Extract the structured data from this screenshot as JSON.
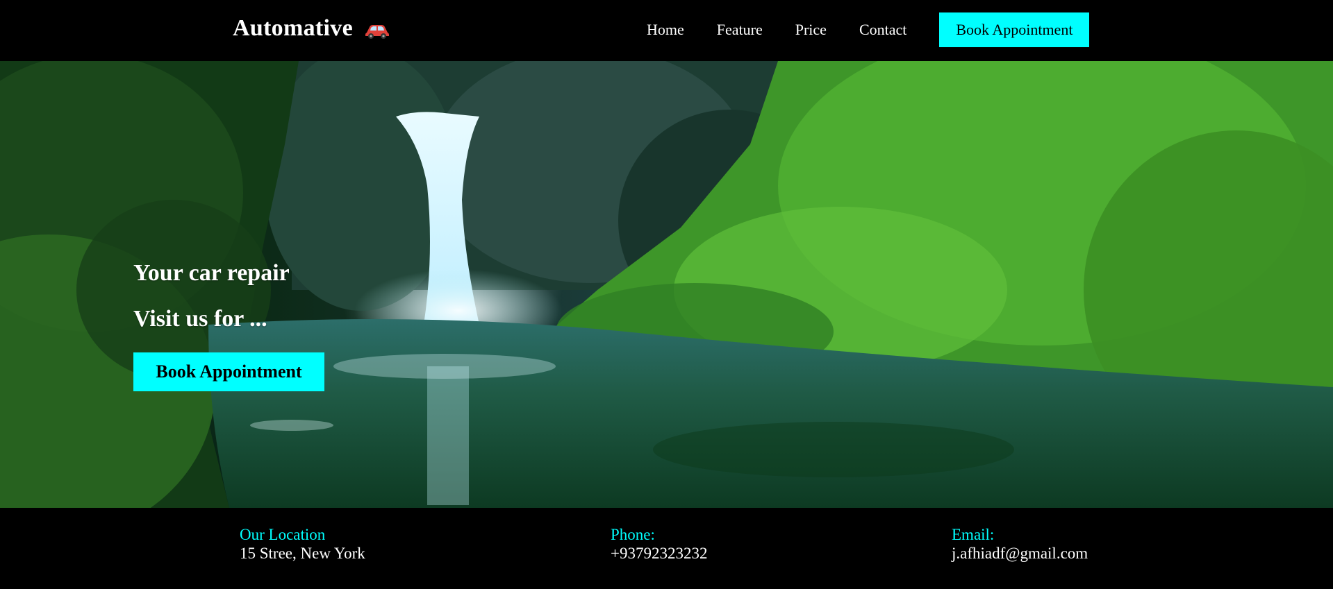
{
  "brand": {
    "name": "Automative",
    "icon": "car-icon"
  },
  "nav": {
    "items": [
      "Home",
      "Feature",
      "Price",
      "Contact"
    ],
    "cta_label": "Book Appointment"
  },
  "hero": {
    "line1": "Your car repair",
    "line2": "Visit us for ...",
    "cta_label": "Book Appointment",
    "image": "waterfall-forest-background"
  },
  "footer": {
    "location": {
      "label": "Our Location",
      "value": "15 Stree, New York"
    },
    "phone": {
      "label": "Phone:",
      "value": "+93792323232"
    },
    "email": {
      "label": "Email:",
      "value": "j.afhiadf@gmail.com"
    }
  },
  "colors": {
    "accent": "#00ffff",
    "header_bg": "#000000",
    "footer_bg": "#000000"
  }
}
